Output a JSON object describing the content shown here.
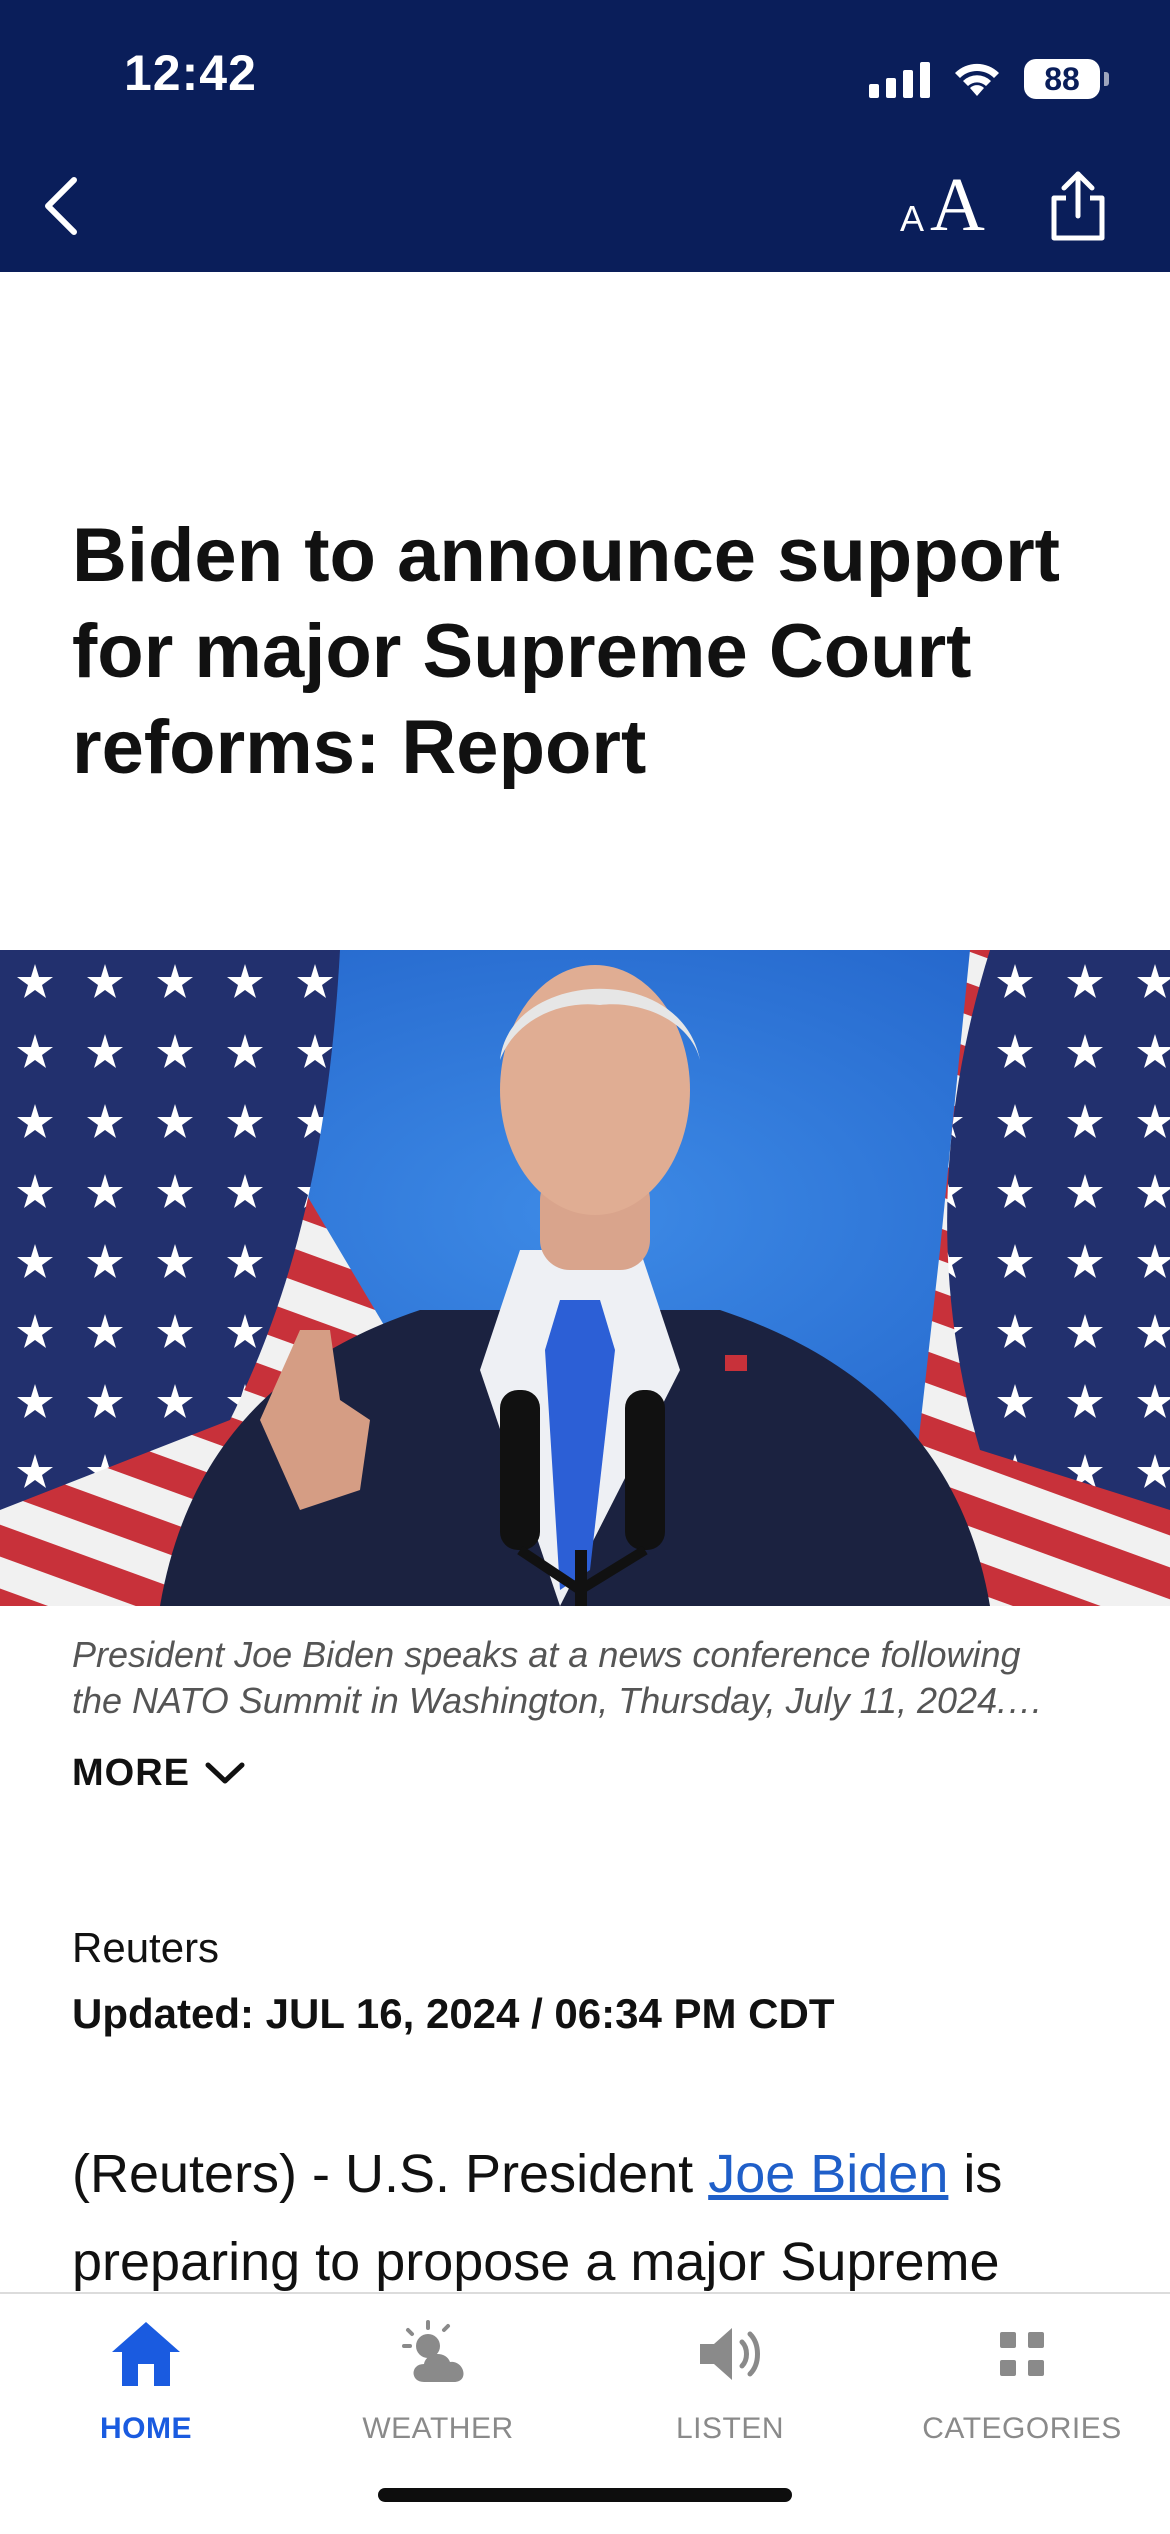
{
  "status_bar": {
    "time": "12:42",
    "battery": "88"
  },
  "header": {
    "back_icon": "chevron-left-icon",
    "text_size_small": "A",
    "text_size_large": "A",
    "share_icon": "share-icon"
  },
  "article": {
    "headline": "Biden to announce support for major Supreme Court reforms: Report",
    "image_description_icon": "photo",
    "caption_line1": "President Joe Biden speaks at a news conference following",
    "caption_line2": "the NATO Summit in Washington, Thursday, July 11, 2024.…",
    "more_label": "MORE",
    "source": "Reuters",
    "updated": "Updated: JUL 16, 2024 / 06:34 PM CDT",
    "body_prefix": "(Reuters) - U.S. President ",
    "body_link": "Joe Biden",
    "body_suffix": " is preparing to propose a major Supreme"
  },
  "bottom_nav": {
    "items": [
      {
        "label": "HOME",
        "icon": "home-icon",
        "active": true
      },
      {
        "label": "WEATHER",
        "icon": "weather-icon",
        "active": false
      },
      {
        "label": "LISTEN",
        "icon": "speaker-icon",
        "active": false
      },
      {
        "label": "CATEGORIES",
        "icon": "grid-icon",
        "active": false
      }
    ]
  },
  "colors": {
    "header_bg": "#0a1e5a",
    "accent": "#1a5be0",
    "link": "#1f5fc9"
  }
}
